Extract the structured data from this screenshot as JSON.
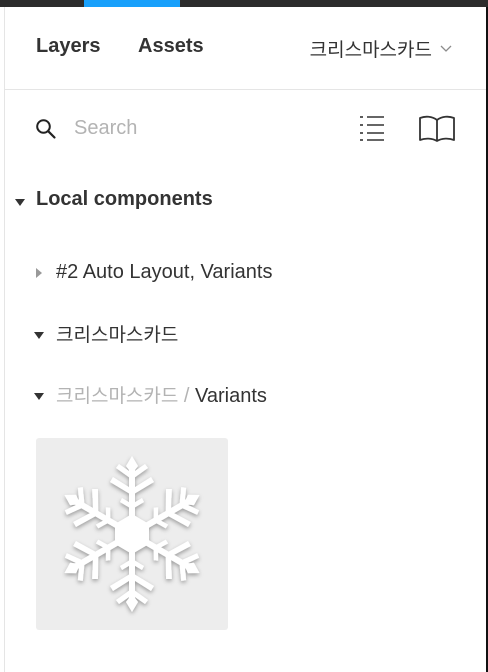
{
  "tabs": {
    "layers": "Layers",
    "assets": "Assets"
  },
  "page_picker": {
    "label": "크리스마스카드"
  },
  "search": {
    "placeholder": "Search"
  },
  "local_components": {
    "title": "Local components",
    "groups": [
      {
        "label": "#2 Auto Layout, Variants",
        "expanded": false
      },
      {
        "label": "크리스마스카드",
        "expanded": true
      },
      {
        "parent": "크리스마스카드",
        "separator": " / ",
        "label": "Variants",
        "expanded": true
      }
    ],
    "component_thumbnail": "snowflake"
  },
  "colors": {
    "accent": "#18a0fb",
    "text": "#333333",
    "muted": "#b3b3b3",
    "thumbnail_bg": "#ededed"
  }
}
